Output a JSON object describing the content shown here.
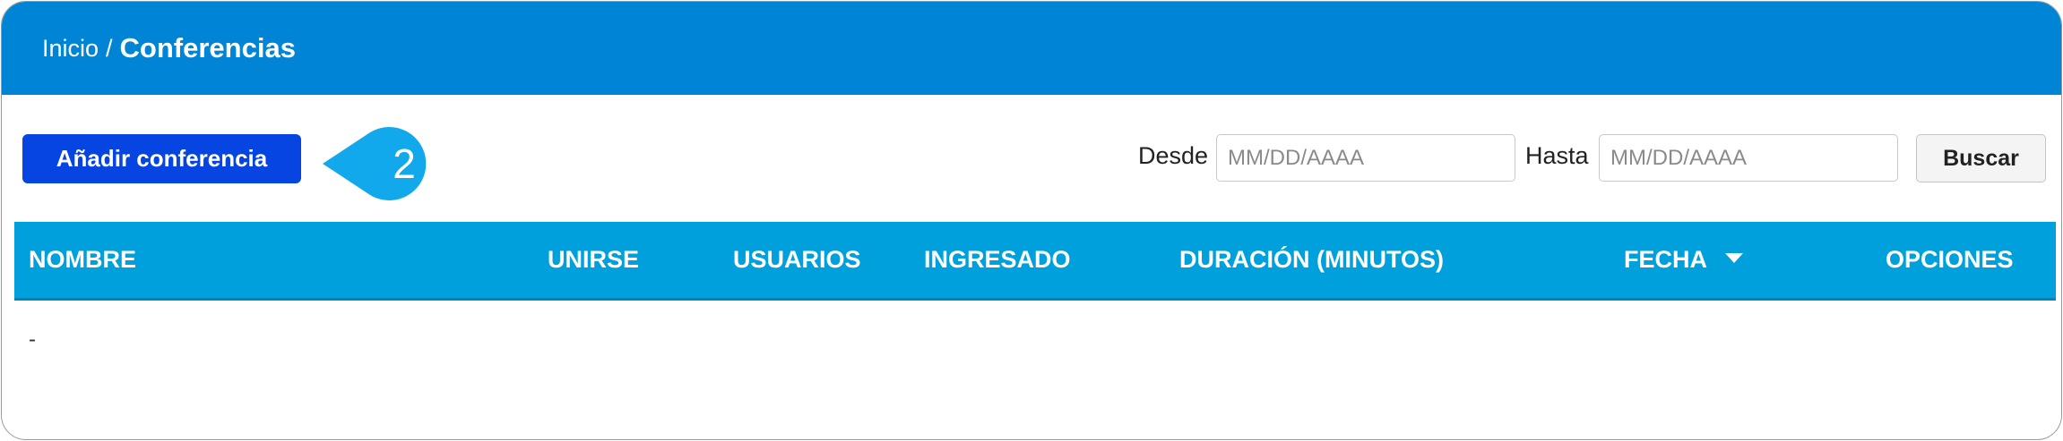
{
  "breadcrumb": {
    "home": "Inicio",
    "separator": "/",
    "current": "Conferencias"
  },
  "toolbar": {
    "add_label": "Añadir conferencia",
    "callout_number": "2",
    "callout_color": "#12a8ec",
    "from_label": "Desde",
    "from_placeholder": "MM/DD/AAAA",
    "to_label": "Hasta",
    "to_placeholder": "MM/DD/AAAA",
    "search_label": "Buscar"
  },
  "table": {
    "columns": [
      "NOMBRE",
      "UNIRSE",
      "USUARIOS",
      "INGRESADO",
      "DURACIÓN (MINUTOS)",
      "FECHA",
      "OPCIONES"
    ],
    "sort_icon": "caret-down-icon",
    "rows": [
      [
        "-"
      ]
    ]
  },
  "colors": {
    "header": "#0084d6",
    "add_button": "#0645e2",
    "table_header": "#00a0dd"
  }
}
